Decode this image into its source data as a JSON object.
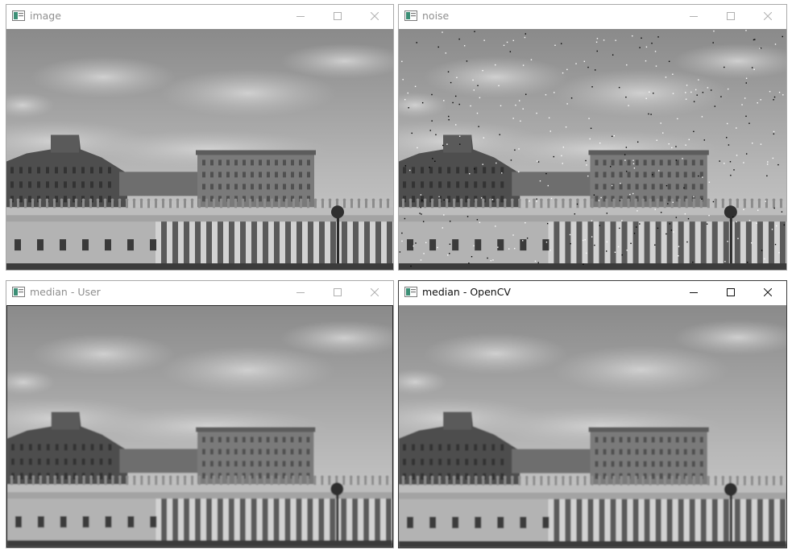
{
  "windows": [
    {
      "title": "image",
      "active": false,
      "noise": false,
      "blur": false
    },
    {
      "title": "noise",
      "active": false,
      "noise": true,
      "blur": false
    },
    {
      "title": "median - User",
      "active": false,
      "noise": false,
      "blur": true
    },
    {
      "title": "median - OpenCV",
      "active": true,
      "noise": false,
      "blur": true
    }
  ],
  "controls": {
    "minimize": "minimize-icon",
    "maximize": "maximize-icon",
    "close": "close-icon"
  },
  "colors": {
    "title_inactive": "#8f8f8f",
    "title_active": "#111111",
    "icon_inactive": "#b0b0b0",
    "icon_active": "#111111"
  }
}
